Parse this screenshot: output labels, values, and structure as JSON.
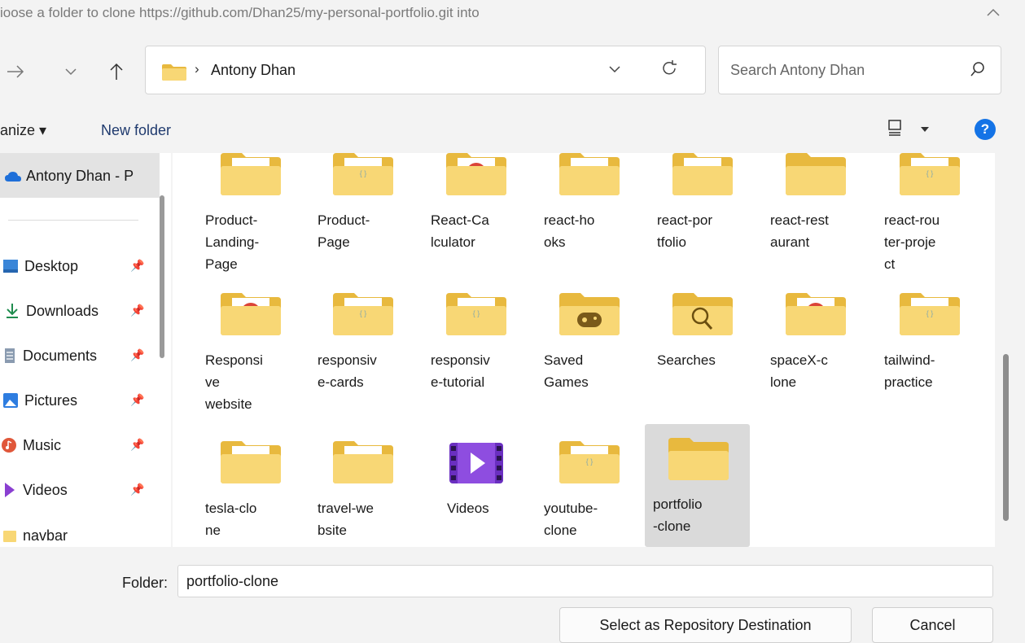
{
  "window": {
    "title": "ioose a folder to clone https://github.com/Dhan25/my-personal-portfolio.git into"
  },
  "address_bar": {
    "path": "Antony Dhan",
    "separator": "›"
  },
  "search": {
    "placeholder": "Search Antony Dhan"
  },
  "toolbar": {
    "organize_label": "anize ▾",
    "new_folder_label": "New folder",
    "help_label": "?"
  },
  "sidebar": {
    "top_item": "Antony Dhan - P",
    "items": [
      {
        "label": "Desktop",
        "icon": "desktop-icon"
      },
      {
        "label": "Downloads",
        "icon": "download-icon"
      },
      {
        "label": "Documents",
        "icon": "documents-icon"
      },
      {
        "label": "Pictures",
        "icon": "pictures-icon"
      },
      {
        "label": "Music",
        "icon": "music-icon"
      },
      {
        "label": "Videos",
        "icon": "videos-icon"
      },
      {
        "label": "navbar",
        "icon": "folder-icon"
      }
    ]
  },
  "folders": [
    {
      "name": "Product-\nLanding-\nPage",
      "icon": "folder-file"
    },
    {
      "name": "Product-\nPage",
      "icon": "folder-code"
    },
    {
      "name": "React-Ca\nlculator",
      "icon": "folder-chrome"
    },
    {
      "name": "react-ho\noks",
      "icon": "folder-file"
    },
    {
      "name": "react-por\ntfolio",
      "icon": "folder-file"
    },
    {
      "name": "react-rest\naurant",
      "icon": "folder-plain"
    },
    {
      "name": "react-rou\nter-proje\nct",
      "icon": "folder-code"
    },
    {
      "name": "Responsi\nve\nwebsite",
      "icon": "folder-chrome"
    },
    {
      "name": "responsiv\ne-cards",
      "icon": "folder-code"
    },
    {
      "name": "responsiv\ne-tutorial",
      "icon": "folder-code"
    },
    {
      "name": "Saved\nGames",
      "icon": "folder-games"
    },
    {
      "name": "Searches",
      "icon": "folder-search"
    },
    {
      "name": "spaceX-c\nlone",
      "icon": "folder-chrome"
    },
    {
      "name": "tailwind-\npractice",
      "icon": "folder-code"
    },
    {
      "name": "tesla-clo\nne",
      "icon": "folder-file"
    },
    {
      "name": "travel-we\nbsite",
      "icon": "folder-file"
    },
    {
      "name": "Videos",
      "icon": "videos-library"
    },
    {
      "name": "youtube-\nclone",
      "icon": "folder-code"
    },
    {
      "name": "portfolio\n-clone",
      "icon": "folder-plain",
      "selected": true
    }
  ],
  "bottom": {
    "folder_label": "Folder:",
    "folder_value": "portfolio-clone",
    "select_button": "Select as Repository Destination",
    "cancel_button": "Cancel"
  },
  "colors": {
    "folder_yellow": "#f8d775",
    "folder_dark": "#e8b93e",
    "accent_blue": "#1473e6"
  }
}
